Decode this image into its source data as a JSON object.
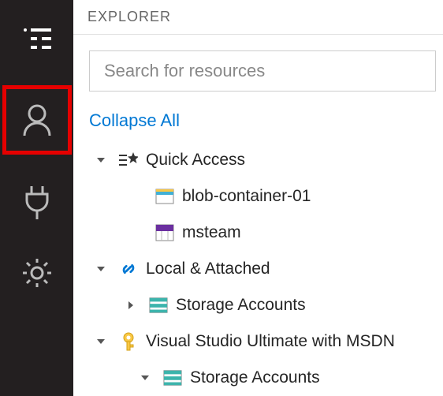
{
  "header": {
    "title": "EXPLORER"
  },
  "search": {
    "placeholder": "Search for resources"
  },
  "actions": {
    "collapse_all": "Collapse All"
  },
  "sidebar_icons": [
    "explorer",
    "account",
    "plug",
    "settings"
  ],
  "tree": {
    "quick_access": {
      "label": "Quick Access",
      "items": [
        {
          "label": "blob-container-01",
          "icon": "container"
        },
        {
          "label": "msteam",
          "icon": "table"
        }
      ]
    },
    "local_attached": {
      "label": "Local & Attached",
      "items": [
        {
          "label": "Storage Accounts",
          "icon": "storage"
        }
      ]
    },
    "subscription": {
      "label": "Visual Studio Ultimate with MSDN",
      "items": [
        {
          "label": "Storage Accounts",
          "icon": "storage"
        }
      ]
    }
  }
}
